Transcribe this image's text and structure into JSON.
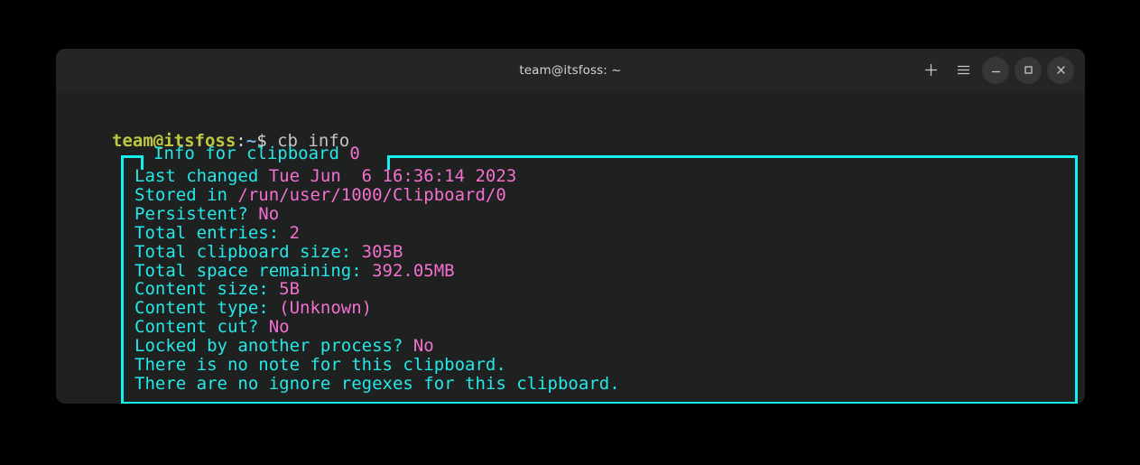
{
  "window": {
    "title": "team@itsfoss: ~",
    "controls": [
      {
        "name": "new-tab-button",
        "icon": "plus-icon",
        "style": "flat"
      },
      {
        "name": "menu-button",
        "icon": "hamburger-menu-icon",
        "style": "flat"
      },
      {
        "name": "minimize-button",
        "icon": "minimize-icon",
        "style": "circle"
      },
      {
        "name": "maximize-button",
        "icon": "maximize-icon",
        "style": "circle"
      },
      {
        "name": "close-button",
        "icon": "close-icon",
        "style": "circle"
      }
    ]
  },
  "colors": {
    "page_background": "#000000",
    "terminal_background": "#1f2020",
    "titlebar_background": "#242526",
    "label_cyan": "#25e8e8",
    "value_magenta": "#f36fd0",
    "border_cyan": "#16f0f0",
    "prompt_user": "#c0c741",
    "prompt_path": "#7fb2e5",
    "command_text": "#c4c4c4"
  },
  "prompt": {
    "user_host": "team@itsfoss",
    "colon": ":",
    "path": "~",
    "dollar": "$",
    "command": "cb info",
    "cursor": " "
  },
  "info_box": {
    "title_prefix": "Info for clipboard ",
    "title_value": "0",
    "rows": [
      {
        "label": "Last changed ",
        "value": "Tue Jun  6 16:36:14 2023"
      },
      {
        "label": "Stored in ",
        "value": "/run/user/1000/Clipboard/0"
      },
      {
        "label": "Persistent? ",
        "value": "No"
      },
      {
        "label": "Total entries: ",
        "value": "2"
      },
      {
        "label": "Total clipboard size: ",
        "value": "305B"
      },
      {
        "label": "Total space remaining: ",
        "value": "392.05MB"
      },
      {
        "label": "Content size: ",
        "value": "5B"
      },
      {
        "label": "Content type: ",
        "value": "(Unknown)"
      },
      {
        "label": "Content cut? ",
        "value": "No"
      },
      {
        "label": "Locked by another process? ",
        "value": "No"
      },
      {
        "label": "There is no note for this clipboard.",
        "value": ""
      },
      {
        "label": "There are no ignore regexes for this clipboard.",
        "value": ""
      }
    ]
  }
}
